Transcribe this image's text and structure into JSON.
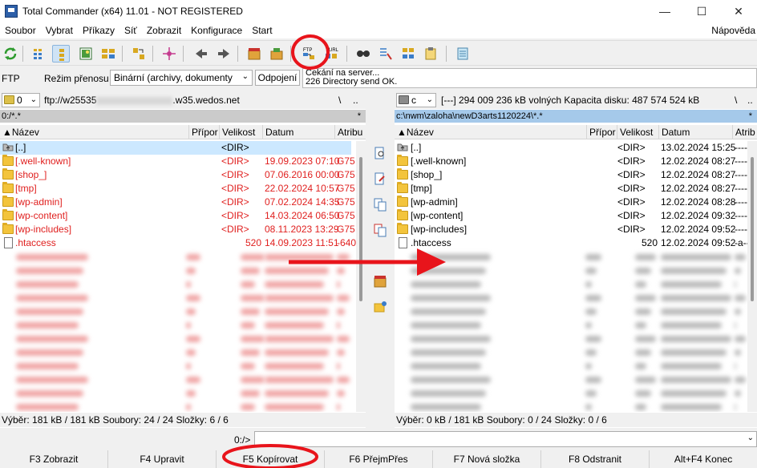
{
  "window": {
    "title": "Total Commander (x64) 11.01 - NOT REGISTERED",
    "minimize_glyph": "—",
    "maximize_glyph": "☐",
    "close_glyph": "✕"
  },
  "menu": {
    "items": [
      "Soubor",
      "Vybrat",
      "Příkazy",
      "Síť",
      "Zobrazit",
      "Konfigurace",
      "Start"
    ],
    "help": "Nápověda"
  },
  "toolbar": {
    "icons": [
      "refresh-icon",
      "brief-view-icon",
      "tree-view-icon",
      "thumbnail-view-icon",
      "compare-icon",
      "sync-icon",
      "pack-icon",
      "back-icon",
      "forward-icon",
      "archive-pack-icon",
      "archive-unpack-icon",
      "ftp-connect-icon",
      "ftp-url-icon",
      "search-icon",
      "multi-rename-icon",
      "sync-dirs-icon",
      "notepad-icon",
      "notes-icon"
    ],
    "ftp_label": "FTP",
    "url_label": "URL"
  },
  "ftpbar": {
    "label": "FTP",
    "mode_label": "Režim přenosu",
    "mode_value": "Binární (archivy, dokumenty",
    "disconnect": "Odpojení",
    "log_line1": "Čekání na server...",
    "log_line2": "226 Directory send OK."
  },
  "left": {
    "drive": "0",
    "path_prefix": "ftp://w25535",
    "path_suffix": ".w35.wedos.net",
    "nav_root": "\\",
    "nav_up": "..",
    "path_bar": "0:/*.*",
    "filter_star": "*",
    "columns": [
      "Název",
      "Přípor",
      "Velikost",
      "Datum",
      "Atribu"
    ],
    "rows": [
      {
        "name": "[..]",
        "ext": "",
        "size": "<DIR>",
        "date": "",
        "attr": "",
        "icon": "up-icon",
        "red": false,
        "sel": true
      },
      {
        "name": "[.well-known]",
        "ext": "",
        "size": "<DIR>",
        "date": "19.09.2023 07:10",
        "attr": "G75",
        "icon": "folder-icon",
        "red": true,
        "sel": false
      },
      {
        "name": "[shop_]",
        "ext": "",
        "size": "<DIR>",
        "date": "07.06.2016 00:00",
        "attr": "G75",
        "icon": "folder-icon",
        "red": true,
        "sel": false
      },
      {
        "name": "[tmp]",
        "ext": "",
        "size": "<DIR>",
        "date": "22.02.2024 10:57",
        "attr": "G75",
        "icon": "folder-icon",
        "red": true,
        "sel": false
      },
      {
        "name": "[wp-admin]",
        "ext": "",
        "size": "<DIR>",
        "date": "07.02.2024 14:35",
        "attr": "G75",
        "icon": "folder-icon",
        "red": true,
        "sel": false
      },
      {
        "name": "[wp-content]",
        "ext": "",
        "size": "<DIR>",
        "date": "14.03.2024 06:50",
        "attr": "G75",
        "icon": "folder-icon",
        "red": true,
        "sel": false
      },
      {
        "name": "[wp-includes]",
        "ext": "",
        "size": "<DIR>",
        "date": "08.11.2023 13:29",
        "attr": "G75",
        "icon": "folder-icon",
        "red": true,
        "sel": false
      },
      {
        "name": ".htaccess",
        "ext": "",
        "size": "520",
        "date": "14.09.2023 11:51",
        "attr": "-640",
        "icon": "file-icon",
        "red": true,
        "sel": false
      }
    ],
    "status": "Výběr: 181 kB / 181 kB  Soubory: 24 / 24  Složky: 6 / 6"
  },
  "right": {
    "drive": "c",
    "drive_info": "[---]  294 009 236 kB volných  Kapacita disku: 487 574 524 kB",
    "nav_root": "\\",
    "nav_up": "..",
    "path_bar": "c:\\nwm\\zaloha\\newD3arts1120224\\*.*",
    "filter_star": "*",
    "columns": [
      "Název",
      "Přípor",
      "Velikost",
      "Datum",
      "Atrib"
    ],
    "rows": [
      {
        "name": "[..]",
        "ext": "",
        "size": "<DIR>",
        "date": "13.02.2024 15:25",
        "attr": "----",
        "icon": "up-icon"
      },
      {
        "name": "[.well-known]",
        "ext": "",
        "size": "<DIR>",
        "date": "12.02.2024 08:27",
        "attr": "----",
        "icon": "folder-icon"
      },
      {
        "name": "[shop_]",
        "ext": "",
        "size": "<DIR>",
        "date": "12.02.2024 08:27",
        "attr": "----",
        "icon": "folder-icon"
      },
      {
        "name": "[tmp]",
        "ext": "",
        "size": "<DIR>",
        "date": "12.02.2024 08:27",
        "attr": "----",
        "icon": "folder-icon"
      },
      {
        "name": "[wp-admin]",
        "ext": "",
        "size": "<DIR>",
        "date": "12.02.2024 08:28",
        "attr": "----",
        "icon": "folder-icon"
      },
      {
        "name": "[wp-content]",
        "ext": "",
        "size": "<DIR>",
        "date": "12.02.2024 09:32",
        "attr": "----",
        "icon": "folder-icon"
      },
      {
        "name": "[wp-includes]",
        "ext": "",
        "size": "<DIR>",
        "date": "12.02.2024 09:52",
        "attr": "----",
        "icon": "folder-icon"
      },
      {
        "name": ".htaccess",
        "ext": "",
        "size": "520",
        "date": "12.02.2024 09:52",
        "attr": "-a--",
        "icon": "file-icon"
      }
    ],
    "status": "Výběr: 0 kB / 181 kB  Soubory: 0 / 24  Složky: 0 / 6"
  },
  "cmdline": {
    "label": "0:/>",
    "value": ""
  },
  "fkeys": [
    "F3 Zobrazit",
    "F4 Upravit",
    "F5 Kopírovat",
    "F6 PřejmPřes",
    "F7 Nová složka",
    "F8 Odstranit",
    "Alt+F4 Konec"
  ],
  "colors": {
    "annotation": "#e8141b",
    "red_text": "#e0201f",
    "active_path": "#a5c9ea",
    "selection": "#cce8ff"
  }
}
